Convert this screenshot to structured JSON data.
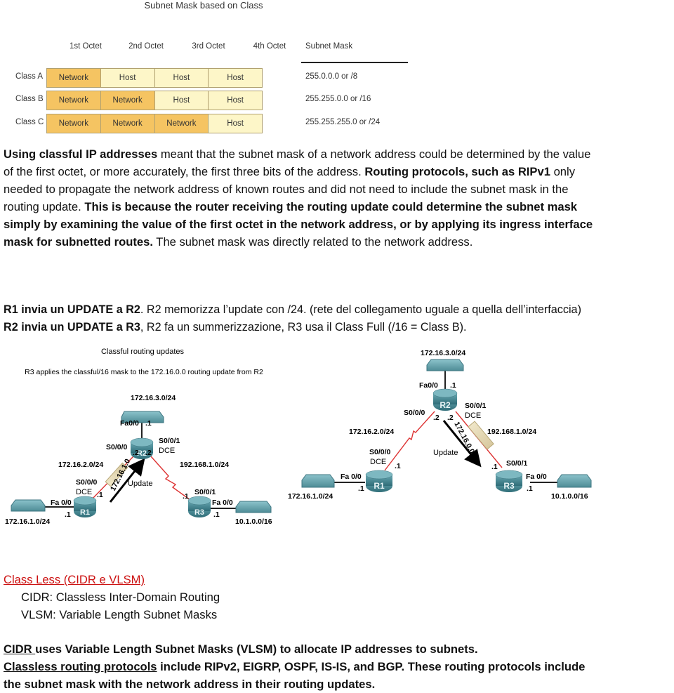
{
  "figure1": {
    "title": "Subnet Mask based on Class",
    "headers": [
      "1st Octet",
      "2nd Octet",
      "3rd Octet",
      "4th Octet",
      "Subnet Mask"
    ],
    "rows": [
      {
        "class": "Class A",
        "cells": [
          "Network",
          "Host",
          "Host",
          "Host"
        ],
        "types": [
          "net",
          "host",
          "host",
          "host"
        ],
        "mask": "255.0.0.0 or /8"
      },
      {
        "class": "Class B",
        "cells": [
          "Network",
          "Network",
          "Host",
          "Host"
        ],
        "types": [
          "net",
          "net",
          "host",
          "host"
        ],
        "mask": "255.255.0.0 or /16"
      },
      {
        "class": "Class C",
        "cells": [
          "Network",
          "Network",
          "Network",
          "Host"
        ],
        "types": [
          "net",
          "net",
          "net",
          "host"
        ],
        "mask": "255.255.255.0 or /24"
      }
    ],
    "colors": {
      "network": "#f5c462",
      "host": "#fdf6c8"
    }
  },
  "paragraph1": {
    "l1_b": "Using classful IP addresses",
    "l1_n": " meant that the subnet mask of a network address could be determined by the value",
    "l2_n": "of the first octet, or more accurately, the first three bits of the address. ",
    "l2_b": "Routing protocols, such as RIPv1",
    "l2_n2": " only",
    "l3_n": "needed to propagate the network address of known routes and did not need to include the subnet mask in the",
    "l4_n": "routing update. ",
    "l4_b": "This is because the router receiving the routing update could determine the subnet mask",
    "l5_b": "simply by examining the value of the first octet in the network address, or by applying its ingress interface",
    "l6_b": "mask for subnetted routes.",
    "l6_n": " The subnet mask was directly related to the network address."
  },
  "paragraph2": {
    "l1_b": "R1 invia un UPDATE a R2",
    "l1_n": ". R2 memorizza l’update con /24. (rete del collegamento uguale a quella dell’interfaccia)",
    "l2_b": "R2 invia un UPDATE a R3",
    "l2_n": ", R2 fa un summerizzazione, R3 usa il Class Full (/16 = Class B)."
  },
  "diagram_left": {
    "title": "Classful routing updates",
    "subtitle": "R3 applies the classful/16 mask to the 172.16.0.0 routing update from R2",
    "net_top": "172.16.3.0/24",
    "r2_fa": "Fa0/0",
    "r2_fa_ip": ".1",
    "r2_s000": "S0/0/0",
    "r2_s001": "S0/0/1",
    "r2_dce": "DCE",
    "r2_ip_left": ".2",
    "r2_ip_right": ".2",
    "net_left_link": "172.16.2.0/24",
    "net_right_link": "192.168.1.0/24",
    "r1_s000": "S0/0/0",
    "r1_dce": "DCE",
    "r1_ip": ".1",
    "r1_fa": "Fa 0/0",
    "r1_fa_ip": ".1",
    "net_r1": "172.16.1.0/24",
    "r3_s001": "S0/0/1",
    "r3_ip": ".1",
    "r3_fa": "Fa 0/0",
    "r3_fa_ip": ".1",
    "net_r3": "10.1.0.0/16",
    "update_label": "Update",
    "update_route": "172.16.1.0",
    "routers": [
      "R1",
      "R2",
      "R3"
    ]
  },
  "diagram_right": {
    "net_top": "172.16.3.0/24",
    "r2_fa": "Fa0/0",
    "r2_fa_ip": ".1",
    "r2_s000": "S0/0/0",
    "r2_s001": "S0/0/1",
    "r2_dce": "DCE",
    "r2_ip_left": ".2",
    "r2_ip_right": ".2",
    "net_left_link": "172.16.2.0/24",
    "net_right_link": "192.168.1.0/24",
    "r1_s000": "S0/0/0",
    "r1_dce": "DCE",
    "r1_ip": ".1",
    "r1_fa": "Fa 0/0",
    "r1_fa_ip": ".1",
    "net_r1": "172.16.1.0/24",
    "r3_s001": "S0/0/1",
    "r3_ip": ".1",
    "r3_fa": "Fa 0/0",
    "r3_fa_ip": ".1",
    "net_r3": "10.1.0.0/16",
    "update_label": "Update",
    "update_route": "172.16.0.0",
    "routers": [
      "R1",
      "R2",
      "R3"
    ]
  },
  "classless": {
    "heading": "Class Less (CIDR e VLSM)",
    "cidr_def": "CIDR: Classless Inter-Domain Routing",
    "vlsm_def": "VLSM: Variable Length Subnet Masks",
    "l1_u": "CIDR ",
    "l1_b": "uses Variable Length Subnet Masks (VLSM) to allocate IP addresses to subnets.",
    "l2_u": "Classless routing protocols",
    "l2_b": " include RIPv2, EIGRP, OSPF, IS-IS, and BGP. These routing protocols include",
    "l3_b": "the subnet mask with the network address in their routing updates.",
    "heading_color": "#cc1111"
  }
}
